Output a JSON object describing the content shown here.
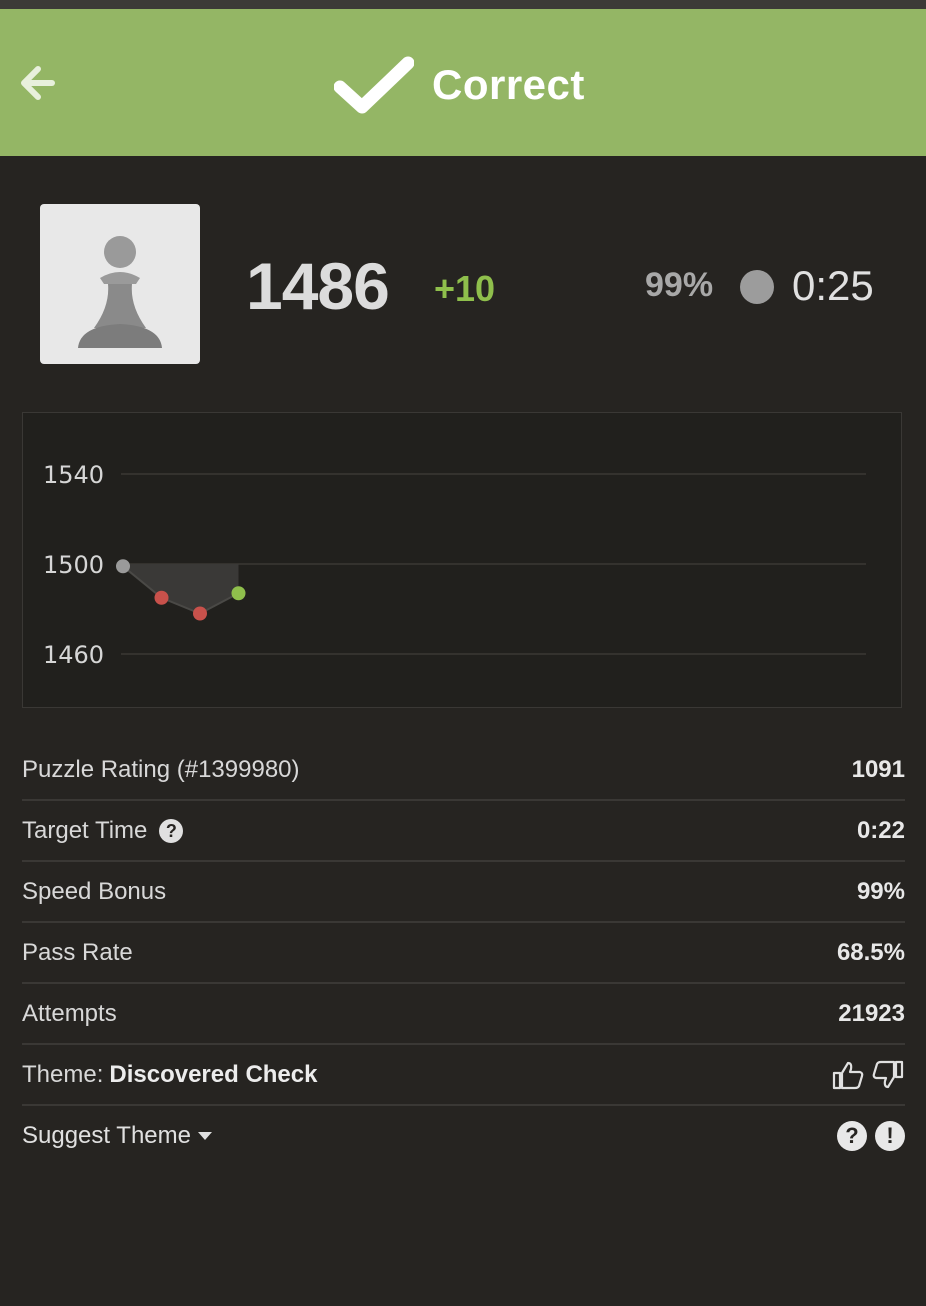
{
  "header": {
    "title": "Correct",
    "back_icon": "arrow-left-icon",
    "check_icon": "checkmark-icon",
    "background": "#94b665"
  },
  "summary": {
    "avatar_icon": "pawn-icon",
    "rating": "1486",
    "rating_change": "+10",
    "speed_percent": "99%",
    "time": "0:25",
    "change_color": "#8fbf4c"
  },
  "chart_data": {
    "type": "line",
    "y_ticks": [
      "1540",
      "1500",
      "1460"
    ],
    "ylim": [
      1460,
      1540
    ],
    "x": [
      1,
      2,
      3,
      4
    ],
    "values": [
      1499,
      1485,
      1478,
      1487
    ],
    "point_colors": [
      "#9a9a9a",
      "#c8514b",
      "#c8514b",
      "#8fbf4c"
    ],
    "baseline": 1500,
    "grid": true
  },
  "stats": {
    "puzzle_rating_label": "Puzzle Rating (#1399980)",
    "puzzle_rating_value": "1091",
    "target_time_label": "Target Time",
    "target_time_value": "0:22",
    "speed_bonus_label": "Speed Bonus",
    "speed_bonus_value": "99%",
    "pass_rate_label": "Pass Rate",
    "pass_rate_value": "68.5%",
    "attempts_label": "Attempts",
    "attempts_value": "21923",
    "theme_label": "Theme:",
    "theme_value": "Discovered Check",
    "suggest_theme_label": "Suggest Theme",
    "help_glyph": "?",
    "report_glyph": "!"
  }
}
